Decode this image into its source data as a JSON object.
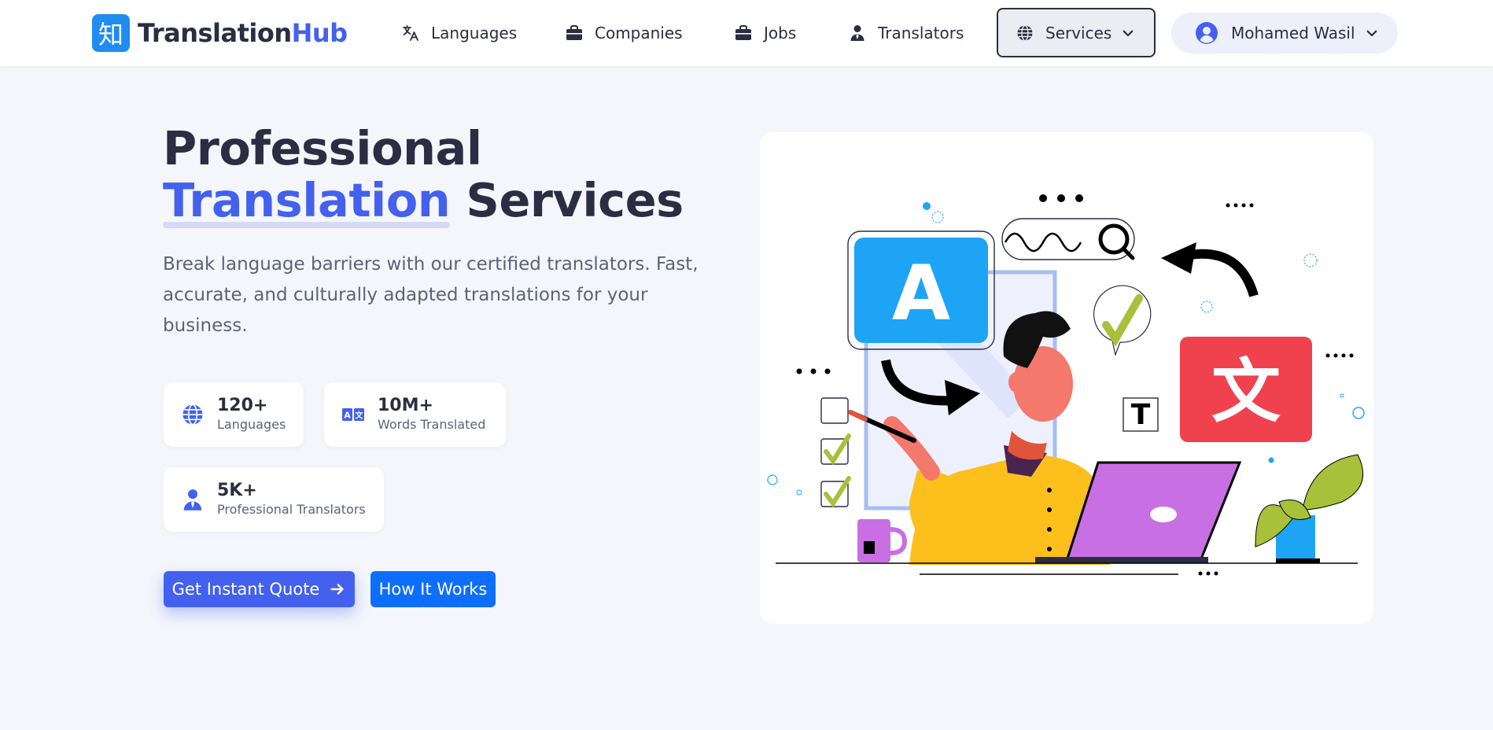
{
  "brand": {
    "mark": "知",
    "name_part1": "Translation",
    "name_part2": "Hub"
  },
  "nav": {
    "languages": "Languages",
    "companies": "Companies",
    "jobs": "Jobs",
    "translators": "Translators",
    "services": "Services",
    "user": "Mohamed Wasil"
  },
  "hero": {
    "title_line1": "Professional",
    "title_accent": "Translation",
    "title_rest": "Services",
    "description": "Break language barriers with our certified translators. Fast, accurate, and culturally adapted translations for your business."
  },
  "stats": [
    {
      "value": "120+",
      "label": "Languages",
      "icon": "globe-icon"
    },
    {
      "value": "10M+",
      "label": "Words Translated",
      "icon": "translate-icon"
    },
    {
      "value": "5K+",
      "label": "Professional Translators",
      "icon": "user-tie-icon"
    }
  ],
  "buttons": {
    "quote": "Get Instant Quote",
    "how": "How It Works"
  },
  "illustration": {
    "letter_a": "A",
    "letter_cjk": "文",
    "letter_t": "T"
  },
  "colors": {
    "accent": "#4361ee",
    "primary_button": "#0d6efd",
    "brand_mark": "#1e8cf0",
    "text_dark": "#2b2d42",
    "text_muted": "#5c6378",
    "background": "#f4f6fb"
  }
}
